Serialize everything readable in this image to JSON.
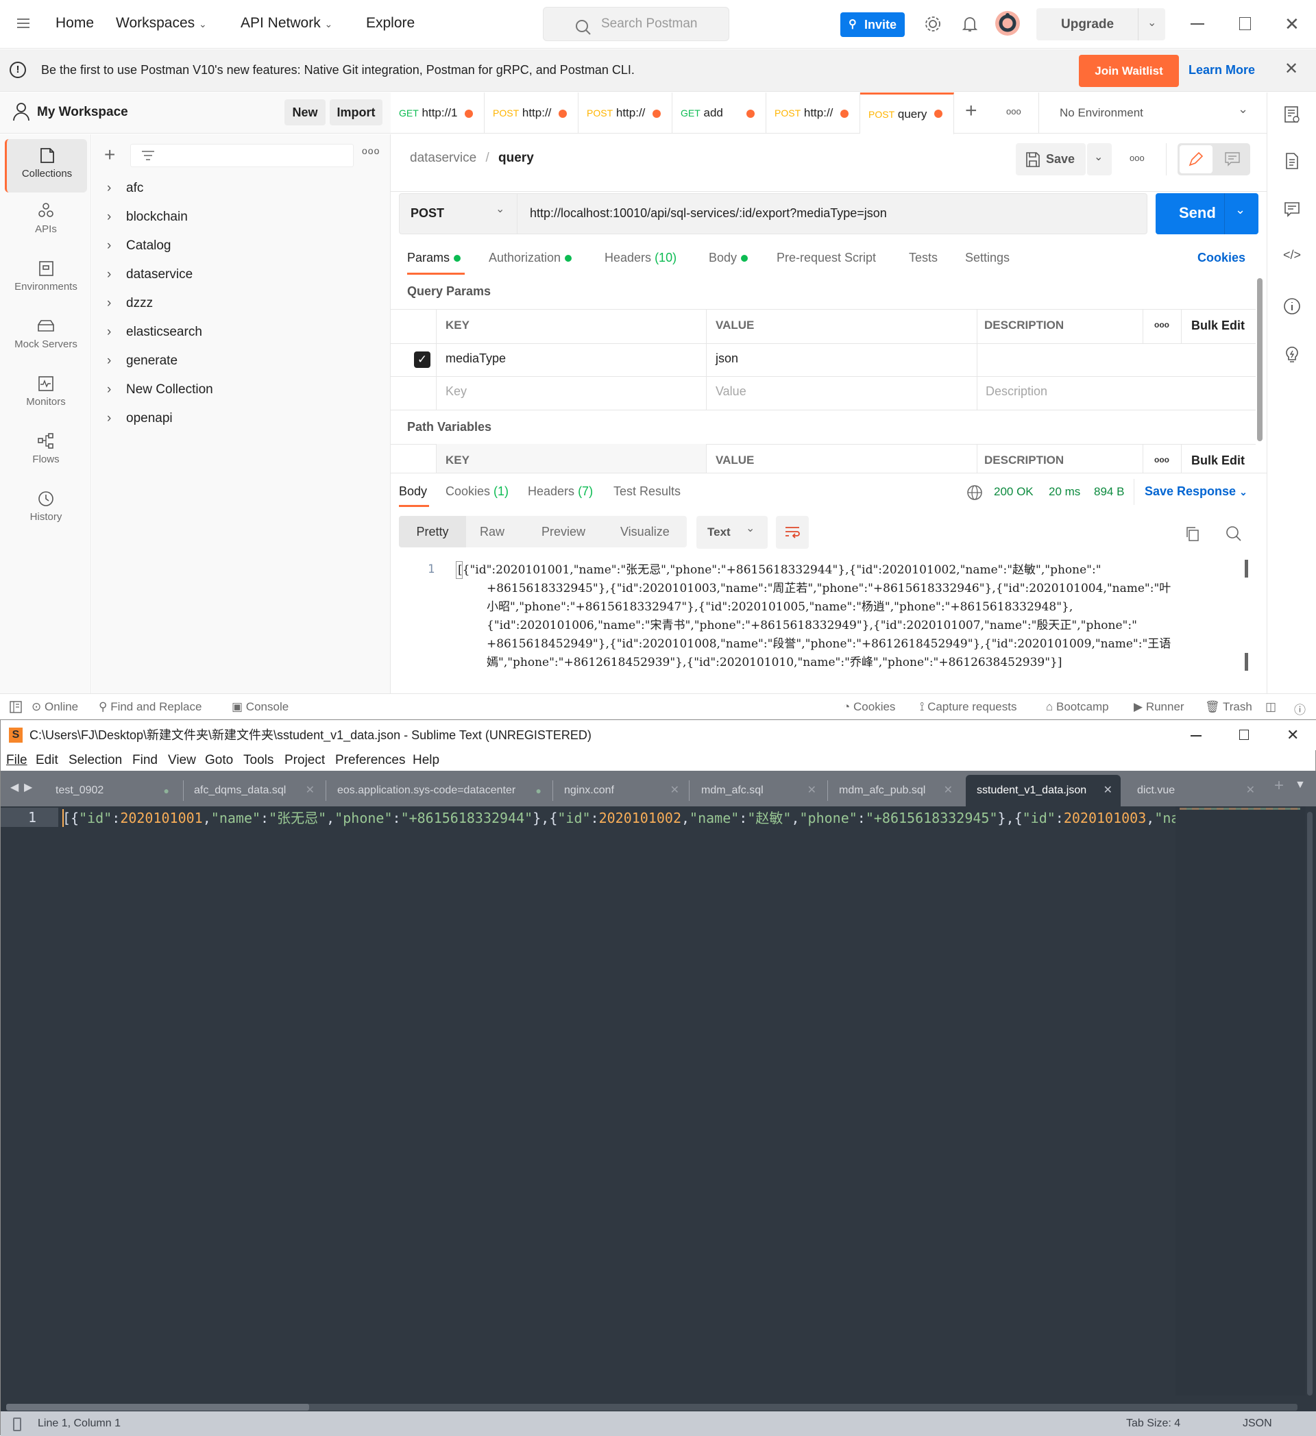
{
  "topbar": {
    "nav": [
      "Home",
      "Workspaces",
      "API Network",
      "Explore"
    ],
    "search_placeholder": "Search Postman",
    "invite_label": "Invite",
    "upgrade_label": "Upgrade"
  },
  "banner": {
    "text": "Be the first to use Postman V10's new features: Native Git integration, Postman for gRPC, and Postman CLI.",
    "join_label": "Join Waitlist",
    "learn_label": "Learn More"
  },
  "workspace": {
    "title": "My Workspace",
    "new_label": "New",
    "import_label": "Import"
  },
  "rail": [
    {
      "label": "Collections",
      "icon": "collections-icon",
      "active": true
    },
    {
      "label": "APIs",
      "icon": "apis-icon"
    },
    {
      "label": "Environments",
      "icon": "environments-icon"
    },
    {
      "label": "Mock Servers",
      "icon": "mock-servers-icon"
    },
    {
      "label": "Monitors",
      "icon": "monitors-icon"
    },
    {
      "label": "Flows",
      "icon": "flows-icon"
    },
    {
      "label": "History",
      "icon": "history-icon"
    }
  ],
  "collections": [
    "afc",
    "blockchain",
    "Catalog",
    "dataservice",
    "dzzz",
    "elasticsearch",
    "generate",
    "New Collection",
    "openapi"
  ],
  "request_tabs": [
    {
      "method": "GET",
      "name": "http://1"
    },
    {
      "method": "POST",
      "name": "http://"
    },
    {
      "method": "POST",
      "name": "http://"
    },
    {
      "method": "GET",
      "name": "add"
    },
    {
      "method": "POST",
      "name": "http://"
    },
    {
      "method": "POST",
      "name": "query",
      "active": true
    }
  ],
  "environment": "No Environment",
  "breadcrumb": {
    "parent": "dataservice",
    "sep": "/",
    "current": "query"
  },
  "save_label": "Save",
  "request": {
    "method": "POST",
    "url": "http://localhost:10010/api/sql-services/:id/export?mediaType=json",
    "send_label": "Send"
  },
  "req_tabs": {
    "params": "Params",
    "auth": "Authorization",
    "headers": "Headers",
    "headers_count": "(10)",
    "body": "Body",
    "prereq": "Pre-request Script",
    "tests": "Tests",
    "settings": "Settings",
    "cookies": "Cookies"
  },
  "query_params": {
    "title": "Query Params",
    "headers": [
      "KEY",
      "VALUE",
      "DESCRIPTION"
    ],
    "bulk_edit": "Bulk Edit",
    "rows": [
      {
        "checked": true,
        "key": "mediaType",
        "value": "json",
        "description": ""
      }
    ],
    "placeholders": {
      "key": "Key",
      "value": "Value",
      "description": "Description"
    }
  },
  "path_vars": {
    "title": "Path Variables",
    "headers": [
      "KEY",
      "VALUE",
      "DESCRIPTION"
    ],
    "bulk_edit": "Bulk Edit"
  },
  "response": {
    "tabs": {
      "body": "Body",
      "cookies": "Cookies",
      "cookies_count": "(1)",
      "headers": "Headers",
      "headers_count": "(7)",
      "tests": "Test Results"
    },
    "status": "200 OK",
    "time": "20 ms",
    "size": "894 B",
    "save_label": "Save Response",
    "views": [
      "Pretty",
      "Raw",
      "Preview",
      "Visualize"
    ],
    "format": "Text",
    "line_no": "1",
    "lines": [
      "[{\"id\":2020101001,\"name\":\"张无忌\",\"phone\":\"+8615618332944\"},{\"id\":2020101002,\"name\":\"赵敏\",\"phone\":\"",
      "+8615618332945\"},{\"id\":2020101003,\"name\":\"周芷若\",\"phone\":\"+8615618332946\"},{\"id\":2020101004,\"name\":\"叶",
      "小昭\",\"phone\":\"+8615618332947\"},{\"id\":2020101005,\"name\":\"杨逍\",\"phone\":\"+8615618332948\"},",
      "{\"id\":2020101006,\"name\":\"宋青书\",\"phone\":\"+8615618332949\"},{\"id\":2020101007,\"name\":\"殷天正\",\"phone\":\"",
      "+8615618452949\"},{\"id\":2020101008,\"name\":\"段誉\",\"phone\":\"+8612618452949\"},{\"id\":2020101009,\"name\":\"王语",
      "嫣\",\"phone\":\"+8612618452939\"},{\"id\":2020101010,\"name\":\"乔峰\",\"phone\":\"+8612638452939\"}]"
    ]
  },
  "pm_footer": {
    "online": "Online",
    "find": "Find and Replace",
    "console": "Console",
    "cookies": "Cookies",
    "capture": "Capture requests",
    "bootcamp": "Bootcamp",
    "runner": "Runner",
    "trash": "Trash"
  },
  "sublime": {
    "title": "C:\\Users\\FJ\\Desktop\\新建文件夹\\新建文件夹\\sstudent_v1_data.json - Sublime Text (UNREGISTERED)",
    "menu": [
      "File",
      "Edit",
      "Selection",
      "Find",
      "View",
      "Goto",
      "Tools",
      "Project",
      "Preferences",
      "Help"
    ],
    "tabs": [
      {
        "name": "test_0902",
        "dirty": true
      },
      {
        "name": "afc_dqms_data.sql"
      },
      {
        "name": "eos.application.sys-code=datacenter",
        "dirty": true
      },
      {
        "name": "nginx.conf"
      },
      {
        "name": "mdm_afc.sql"
      },
      {
        "name": "mdm_afc_pub.sql"
      },
      {
        "name": "sstudent_v1_data.json",
        "active": true
      },
      {
        "name": "dict.vue"
      }
    ],
    "line_no": "1",
    "status_left": "Line 1, Column 1",
    "tab_size": "Tab Size: 4",
    "syntax": "JSON"
  },
  "colors": {
    "accent": "#ff6c37",
    "primary": "#097bed",
    "success": "#0cbb52"
  }
}
